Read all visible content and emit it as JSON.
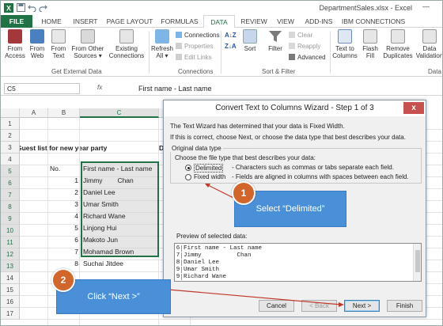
{
  "window": {
    "title": "DepartmentSales.xlsx - Excel"
  },
  "tabs": [
    "FILE",
    "HOME",
    "INSERT",
    "PAGE LAYOUT",
    "FORMULAS",
    "DATA",
    "REVIEW",
    "VIEW",
    "ADD-INS",
    "IBM CONNECTIONS"
  ],
  "active_tab": "DATA",
  "ribbon": {
    "from_access": "From\nAccess",
    "from_web": "From\nWeb",
    "from_text": "From\nText",
    "from_other": "From Other\nSources ▾",
    "existing": "Existing\nConnections",
    "get_external_label": "Get External Data",
    "refresh": "Refresh\nAll ▾",
    "connections": "Connections",
    "properties": "Properties",
    "edit_links": "Edit Links",
    "connections_label": "Connections",
    "sort": "Sort",
    "filter": "Filter",
    "clear": "Clear",
    "reapply": "Reapply",
    "advanced": "Advanced",
    "sort_filter_label": "Sort & Filter",
    "text_to_columns": "Text to\nColumns",
    "flash_fill": "Flash\nFill",
    "remove_dup": "Remove\nDuplicates",
    "data_val": "Data\nValidation",
    "data_tools_label": "Data"
  },
  "formula_bar": {
    "name_box": "C5",
    "fx": "fx",
    "formula": "First name - Last name"
  },
  "columns": [
    "A",
    "B",
    "C",
    "D"
  ],
  "rows": [
    "1",
    "2",
    "3",
    "4",
    "5",
    "6",
    "7",
    "8",
    "9",
    "10",
    "11",
    "12",
    "13",
    "14",
    "15",
    "16",
    "17"
  ],
  "sheet": {
    "title": "Guest list for new year party",
    "no_header": "No.",
    "name_header": "First name - Last name",
    "numbers": [
      "1",
      "2",
      "3",
      "4",
      "5",
      "6",
      "7",
      "8"
    ],
    "names": [
      "Jimmy        Chan",
      "Daniel Lee",
      "Umar Smith",
      "Richard Wane",
      "Linjong Hui",
      "Makoto Jun",
      "Mohamad Brown",
      "Suchai Jitdee"
    ],
    "d3": "D"
  },
  "dialog": {
    "title": "Convert Text to Columns Wizard - Step 1 of 3",
    "close": "x",
    "line1": "The Text Wizard has determined that your data is Fixed Width.",
    "line2": "If this is correct, choose Next, or choose the data type that best describes your data.",
    "group_label": "Original data type",
    "choose_label": "Choose the file type that best describes your data:",
    "opt1": "Delimited",
    "opt1_desc": "- Characters such as commas or tabs separate each field.",
    "opt2": "Fixed width",
    "opt2_desc": "- Fields are aligned in columns with spaces between each field.",
    "preview_label": "Preview of selected data:",
    "preview_nums": [
      "6",
      "7",
      "8",
      "9",
      "9"
    ],
    "preview_lines": [
      "First name - Last name",
      "Jimmy          Chan",
      "Daniel Lee",
      "Umar Smith",
      "Richard Wane"
    ],
    "btn_cancel": "Cancel",
    "btn_back": "< Back",
    "btn_next": "Next >",
    "btn_finish": "Finish"
  },
  "callouts": {
    "one_num": "1",
    "one_text": "Select “Delimited”",
    "two_num": "2",
    "two_text": "Click “Next >”"
  },
  "colors": {
    "excel_green": "#217346",
    "callout_blue": "#4a90d9",
    "badge_orange": "#d2652a"
  }
}
